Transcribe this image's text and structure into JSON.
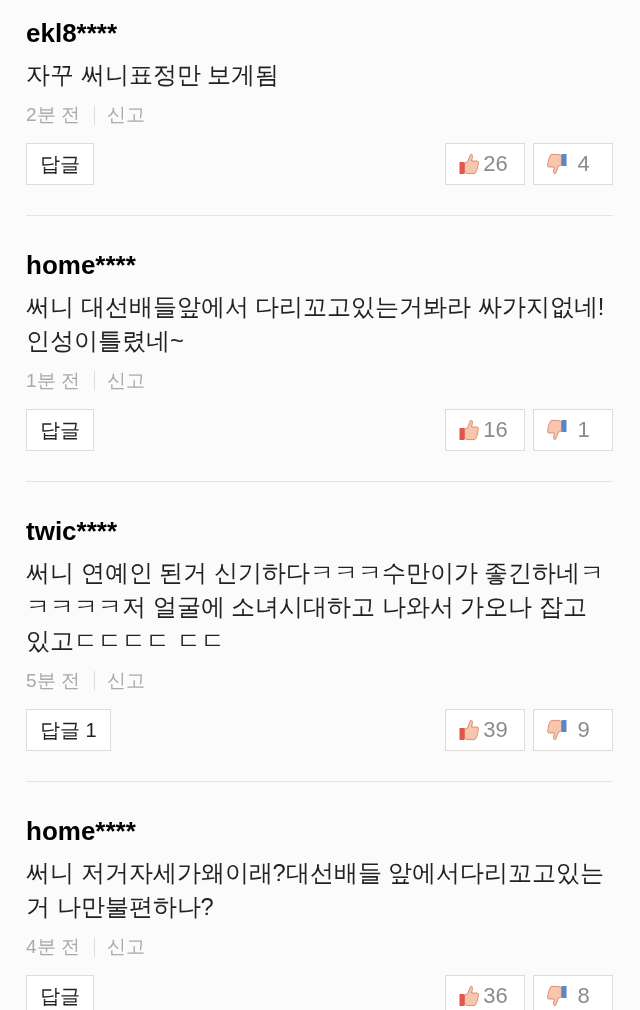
{
  "comments": [
    {
      "username": "ekl8****",
      "text": "자꾸 써니표정만 보게됨",
      "time": "2분 전",
      "report": "신고",
      "reply": {
        "label": "답글"
      },
      "likes": "26",
      "dislikes": "4"
    },
    {
      "username": "home****",
      "text": "써니 대선배들앞에서 다리꼬고있는거봐라 싸가지없네! 인성이틀렸네~",
      "time": "1분 전",
      "report": "신고",
      "reply": {
        "label": "답글"
      },
      "likes": "16",
      "dislikes": "1"
    },
    {
      "username": "twic****",
      "text": "써니 연예인 된거 신기하다ㅋㅋㅋ수만이가 좋긴하네ㅋㅋㅋㅋㅋ저 얼굴에 소녀시대하고 나와서 가오나 잡고 있고ㄷㄷㄷㄷ ㄷㄷ",
      "time": "5분 전",
      "report": "신고",
      "reply": {
        "label": "답글",
        "count": "1"
      },
      "likes": "39",
      "dislikes": "9"
    },
    {
      "username": "home****",
      "text": "써니 저거자세가왜이래?대선배들 앞에서다리꼬고있는거 나만불편하나?",
      "time": "4분 전",
      "report": "신고",
      "reply": {
        "label": "답글"
      },
      "likes": "36",
      "dislikes": "8"
    }
  ]
}
